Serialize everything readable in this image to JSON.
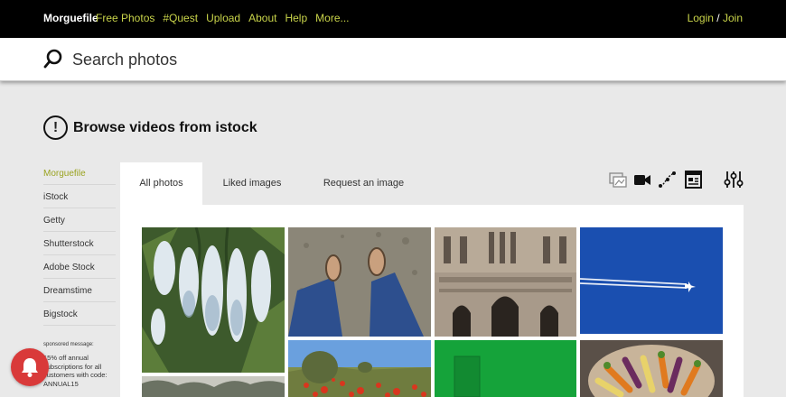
{
  "header": {
    "brand": "Morguefile",
    "nav": [
      "Free Photos",
      "#Quest",
      "Upload",
      "About",
      "Help",
      "More..."
    ],
    "login": "Login",
    "separator": "/",
    "join": "Join"
  },
  "search": {
    "placeholder": "Search photos"
  },
  "page": {
    "title": "Browse videos from istock"
  },
  "sidebar": {
    "items": [
      {
        "label": "Morguefile",
        "active": true
      },
      {
        "label": "iStock"
      },
      {
        "label": "Getty"
      },
      {
        "label": "Shutterstock"
      },
      {
        "label": "Adobe Stock"
      },
      {
        "label": "Dreamstime"
      },
      {
        "label": "Bigstock"
      }
    ],
    "sponsored_label": "sponsored message:",
    "promo": "15% off annual subscriptions for all customers with code: ANNUAL15"
  },
  "tabs": [
    "All photos",
    "Liked images",
    "Request an image"
  ],
  "toolbar_icons": [
    "photos-icon",
    "video-icon",
    "vector-icon",
    "illustration-icon",
    "filter-settings-icon"
  ],
  "colors": {
    "accent": "#c9d44a",
    "sidebar_active": "#9aa320",
    "notification": "#d93a3a"
  },
  "photos": [
    "white-flower-clusters",
    "feet-on-gravel",
    "gothic-cathedral-facade",
    "airplane-in-blue-sky",
    "trees-landscape",
    "red-poppy-field",
    "green-wall-door",
    "bowl-of-carrots"
  ]
}
